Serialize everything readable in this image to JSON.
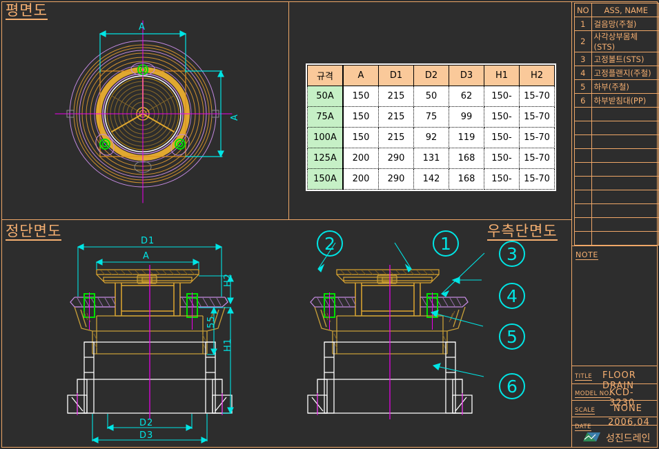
{
  "sheet": {
    "bg_color": "#2d2d2d",
    "frame_color": "#f0a868",
    "dim_color": "#00e5e5"
  },
  "views": {
    "plan": {
      "title": "평면도"
    },
    "front_section": {
      "title": "정단면도"
    },
    "right_section": {
      "title": "우측단면도"
    }
  },
  "spec_table": {
    "headers": [
      "규격",
      "A",
      "D1",
      "D2",
      "D3",
      "H1",
      "H2"
    ],
    "rows": [
      [
        "50A",
        "150",
        "215",
        "50",
        "62",
        "150-",
        "15-70"
      ],
      [
        "75A",
        "150",
        "215",
        "75",
        "99",
        "150-",
        "15-70"
      ],
      [
        "100A",
        "150",
        "215",
        "92",
        "119",
        "150-",
        "15-70"
      ],
      [
        "125A",
        "200",
        "290",
        "131",
        "168",
        "150-",
        "15-70"
      ],
      [
        "150A",
        "200",
        "290",
        "142",
        "168",
        "150-",
        "15-70"
      ]
    ],
    "header_bg": "#fac99a",
    "key_bg": "#c6f0c6"
  },
  "parts_list": {
    "headers": [
      "NO",
      "ASS, NAME"
    ],
    "rows": [
      [
        "1",
        "걸음망(주철)"
      ],
      [
        "2",
        "사각상부몸체(STS)"
      ],
      [
        "3",
        "고정볼트(STS)"
      ],
      [
        "4",
        "고정플랜지(주철)"
      ],
      [
        "5",
        "하부(주철)"
      ],
      [
        "6",
        "하부받침대(PP)"
      ],
      [
        "",
        ""
      ],
      [
        "",
        ""
      ],
      [
        "",
        ""
      ],
      [
        "",
        ""
      ],
      [
        "",
        ""
      ],
      [
        "",
        ""
      ],
      [
        "",
        ""
      ],
      [
        "",
        ""
      ],
      [
        "",
        ""
      ],
      [
        "",
        ""
      ]
    ]
  },
  "note": {
    "label": "NOTE"
  },
  "title_block": {
    "title_label": "TITLE",
    "title_value": "FLOOR DRAIN",
    "model_label": "MODEL NO.",
    "model_value": "KCD-3230",
    "scale_label": "SCALE",
    "scale_value": "NONE",
    "date_label": "DATE",
    "date_value": "2006,04",
    "company": "성진드레인"
  },
  "callouts": [
    {
      "n": "1"
    },
    {
      "n": "2"
    },
    {
      "n": "3"
    },
    {
      "n": "4"
    },
    {
      "n": "5"
    },
    {
      "n": "6"
    }
  ],
  "dimensions": {
    "plan_a_top": "A",
    "plan_a_right": "A",
    "front_d1": "D1",
    "front_a": "A",
    "front_h2": "H2",
    "front_55": "55",
    "front_h1": "H1",
    "front_d2": "D2",
    "front_d3": "D3"
  }
}
